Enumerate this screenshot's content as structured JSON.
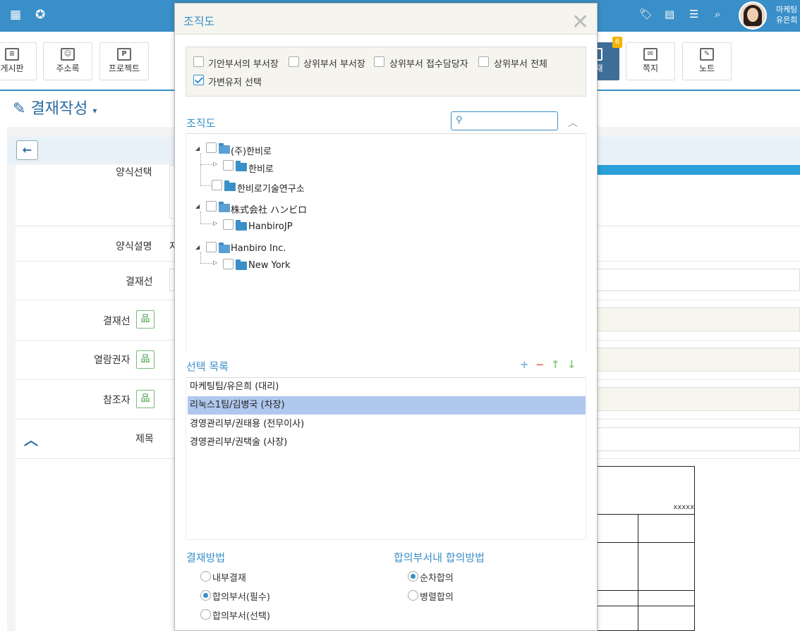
{
  "topbar": {
    "user_line1": "마케팅",
    "user_line2": "유은희"
  },
  "toolbar": {
    "buttons": [
      {
        "label": "게시판"
      },
      {
        "label": "주소록"
      },
      {
        "label": "프로젝트"
      },
      {
        "label": "결재",
        "badge": "6"
      },
      {
        "label": "쪽지"
      },
      {
        "label": "노트"
      }
    ]
  },
  "page": {
    "title": "결재작성",
    "labels": {
      "form_select": "양식선택",
      "form_desc": "양식설명",
      "approval_line1": "결재선",
      "approval_line2": "결재선",
      "viewer": "열람권자",
      "reference": "참조자",
      "subject": "제목"
    },
    "form_desc_value": "자",
    "table_header": "xxxxx"
  },
  "modal": {
    "title": "조직도",
    "options": [
      {
        "label": "기안부서의 부서장",
        "checked": false
      },
      {
        "label": "상위부서 부서장",
        "checked": false
      },
      {
        "label": "상위부서 접수담당자",
        "checked": false
      },
      {
        "label": "상위부서 전체",
        "checked": false
      },
      {
        "label": "가변유저 선택",
        "checked": true
      }
    ],
    "org_section_title": "조직도",
    "search_placeholder": "",
    "tree": [
      {
        "label": "(주)한비로",
        "children": [
          {
            "label": "한비로"
          },
          {
            "label": "한비로기술연구소"
          }
        ]
      },
      {
        "label": "株式会社 ハンビロ",
        "children": [
          {
            "label": "HanbiroJP"
          }
        ]
      },
      {
        "label": "Hanbiro Inc.",
        "children": [
          {
            "label": "New York"
          }
        ]
      }
    ],
    "list_title": "선택 목록",
    "selected_list": [
      {
        "label": "마케팅팀/유은희 (대리)",
        "selected": false
      },
      {
        "label": "리눅스1팀/김병국 (차장)",
        "selected": true
      },
      {
        "label": "경영관리부/권태용 (전무이사)",
        "selected": false
      },
      {
        "label": "경영관리부/권택술 (사장)",
        "selected": false
      }
    ],
    "method_title": "결재방법",
    "methods": [
      {
        "label": "내부결재",
        "checked": false
      },
      {
        "label": "합의부서(필수)",
        "checked": true
      },
      {
        "label": "합의부서(선택)",
        "checked": false
      }
    ],
    "consensus_title": "합의부서내 합의방법",
    "consensus": [
      {
        "label": "순차합의",
        "checked": true
      },
      {
        "label": "병렬합의",
        "checked": false
      }
    ]
  },
  "colors": {
    "brand_blue": "#3a8fc8",
    "selected_row": "#b0c8ee"
  }
}
